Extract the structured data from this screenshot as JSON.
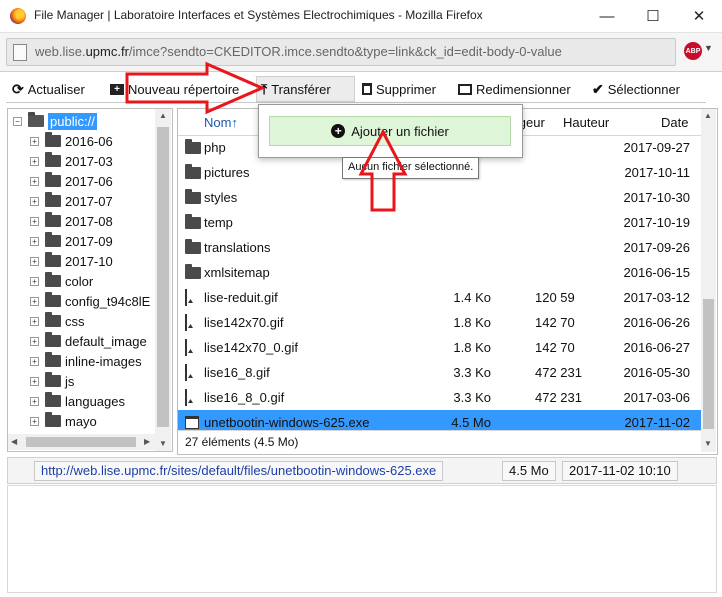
{
  "window": {
    "title": "File Manager | Laboratoire Interfaces et Systèmes Electrochimiques - Mozilla Firefox",
    "minimize_glyph": "—",
    "maximize_glyph": "☐",
    "close_glyph": "✕"
  },
  "address_bar": {
    "url_prefix": "web.lise.",
    "url_domain": "upmc.fr",
    "url_rest": "/imce?sendto=CKEDITOR.imce.sendto&type=link&ck_id=edit-body-0-value",
    "extension_label": "ABP"
  },
  "toolbar": {
    "refresh": "Actualiser",
    "new_folder": "Nouveau répertoire",
    "upload": "Transférer",
    "delete": "Supprimer",
    "resize": "Redimensionner",
    "select": "Sélectionner"
  },
  "tree": {
    "root": "public://",
    "folders": [
      "2016-06",
      "2017-03",
      "2017-06",
      "2017-07",
      "2017-08",
      "2017-09",
      "2017-10",
      "color",
      "config_t94c8lE",
      "css",
      "default_image",
      "inline-images",
      "js",
      "languages",
      "mayo"
    ]
  },
  "file_list": {
    "columns": {
      "name": "Nom↑",
      "width": "Largeur",
      "height": "Hauteur",
      "date": "Date"
    },
    "rows": [
      {
        "name": "php",
        "type": "folder",
        "size": "",
        "dims": "",
        "date": "2017-09-27"
      },
      {
        "name": "pictures",
        "type": "folder",
        "size": "",
        "dims": "",
        "date": "2017-10-11"
      },
      {
        "name": "styles",
        "type": "folder",
        "size": "",
        "dims": "",
        "date": "2017-10-30"
      },
      {
        "name": "temp",
        "type": "folder",
        "size": "",
        "dims": "",
        "date": "2017-10-19"
      },
      {
        "name": "translations",
        "type": "folder",
        "size": "",
        "dims": "",
        "date": "2017-09-26"
      },
      {
        "name": "xmlsitemap",
        "type": "folder",
        "size": "",
        "dims": "",
        "date": "2016-06-15"
      },
      {
        "name": "lise-reduit.gif",
        "type": "gif",
        "size": "1.4 Ko",
        "dims": "120 59",
        "date": "2017-03-12"
      },
      {
        "name": "lise142x70.gif",
        "type": "gif",
        "size": "1.8 Ko",
        "dims": "142 70",
        "date": "2016-06-26"
      },
      {
        "name": "lise142x70_0.gif",
        "type": "gif",
        "size": "1.8 Ko",
        "dims": "142 70",
        "date": "2016-06-27"
      },
      {
        "name": "lise16_8.gif",
        "type": "gif",
        "size": "3.3 Ko",
        "dims": "472 231",
        "date": "2016-05-30"
      },
      {
        "name": "lise16_8_0.gif",
        "type": "gif",
        "size": "3.3 Ko",
        "dims": "472 231",
        "date": "2017-03-06"
      },
      {
        "name": "unetbootin-windows-625.exe",
        "type": "exe",
        "size": "4.5 Mo",
        "dims": "",
        "date": "2017-11-02",
        "selected": true
      }
    ],
    "status": "27 éléments (4.5 Mo)"
  },
  "info_bar": {
    "url": "http://web.lise.upmc.fr/sites/default/files/unetbootin-windows-625.exe",
    "size": "4.5 Mo",
    "datetime": "2017-11-02 10:10"
  },
  "upload_popup": {
    "add_file_label": "Ajouter un fichier",
    "tooltip": "Aucun fichier sélectionné."
  },
  "colors": {
    "selection": "#3399ff",
    "annotation": "#e8151b",
    "add_button_bg": "#dff5d8"
  }
}
